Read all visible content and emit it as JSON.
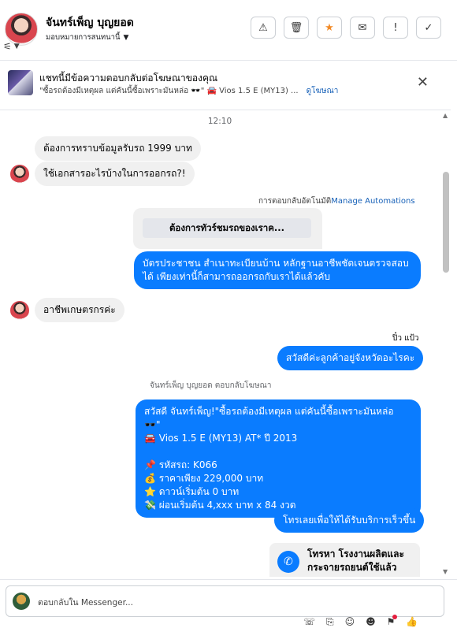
{
  "header": {
    "user_name": "จันทร์เพ็ญ บุญยอด",
    "assign_label": "มอบหมายการสนทนานี้",
    "actions": [
      {
        "name": "spam-button",
        "icon": "⚠"
      },
      {
        "name": "delete-button",
        "icon": "🗑"
      },
      {
        "name": "star-button",
        "icon": "★"
      },
      {
        "name": "mark-unread-button",
        "icon": "✉"
      },
      {
        "name": "follow-up-button",
        "icon": "!"
      },
      {
        "name": "done-button",
        "icon": "✓"
      }
    ]
  },
  "ad_banner": {
    "title": "แชทนี้มีข้อความตอบกลับต่อโฆษณาของคุณ",
    "snippet": "\"ซื้อรถต้องมีเหตุผล แต่คันนี้ซื้อเพราะมันหล่อ 🕶️\" 🚘 Vios 1.5 E (MY13) ...",
    "link": "ดูโฆษณา"
  },
  "chat": {
    "timestamp": "12:10",
    "msg1": "ต้องการทราบข้อมูลรับรถ 1999 บาท",
    "msg2": "ใช้เอกสารอะไรบ้างในการออกรถ?!",
    "auto_reply_label": "การตอบกลับอัตโนมัติ",
    "manage_automations": "Manage Automations",
    "quick_reply": "ต้องการทัวร์ชมรถของเราค...",
    "msg3": "บัตรประชาชน สำเนาทะเบียนบ้าน หลักฐานอาชีพชัดเจนตรวจสอบ\nได้ เพียงเท่านี้ก็สามารถออกรถกับเราได้แล้วคับ",
    "msg4": "อาชีพเกษตรกรค่ะ",
    "sender_name": "ปิ๋ว แป้ว",
    "msg5": "สวัสดีค่ะลูกค้าอยู่จังหวัดอะไรคะ",
    "ad_reply_label": "จันทร์เพ็ญ บุญยอด ตอบกลับโฆษณา",
    "msg6": "สวัสดี จันทร์เพ็ญ!\"ซื้อรถต้องมีเหตุผล แต่คันนี้ซื้อเพราะมันหล่อ 🕶️\"\n🚘 Vios 1.5 E (MY13) AT* ปี 2013\n\n📌 รหัสรถ: K066\n💰 ราคาเพียง 229,000 บาท\n⭐ ดาวน์เริ่มต้น 0 บาท\n💸 ผ่อนเริ่มต้น 4,xxx บาท x 84 งวด",
    "msg7": "โทรเลยเพื่อให้ได้รับบริการเร็วขึ้น",
    "call_card_text": "โทรหา โรงงานผลิตและ\nกระจายรถยนต์ใช้แล้ว"
  },
  "composer": {
    "placeholder": "ตอบกลับใน Messenger..."
  }
}
